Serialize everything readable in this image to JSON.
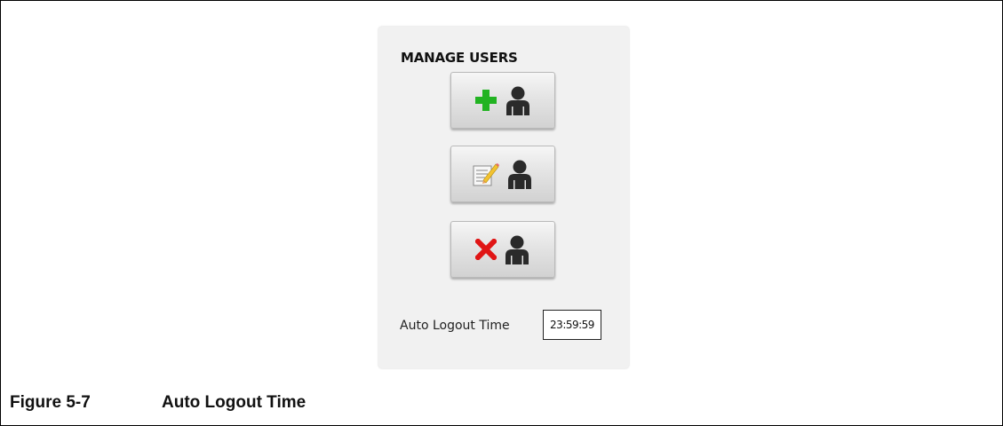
{
  "panel": {
    "title": "MANAGE USERS",
    "buttons": [
      {
        "action": "add-user",
        "icons": [
          "plus-icon",
          "user-icon"
        ]
      },
      {
        "action": "edit-user",
        "icons": [
          "edit-notepad-icon",
          "user-icon"
        ]
      },
      {
        "action": "delete-user",
        "icons": [
          "x-delete-icon",
          "user-icon"
        ]
      }
    ],
    "auto_logout": {
      "label": "Auto Logout Time",
      "value": "23:59:59"
    }
  },
  "figure": {
    "number": "Figure 5-7",
    "title": "Auto Logout Time"
  },
  "colors": {
    "plus": "#22b322",
    "delete": "#e01515",
    "user": "#2a2a2a",
    "panel_bg": "#f1f1f1"
  }
}
